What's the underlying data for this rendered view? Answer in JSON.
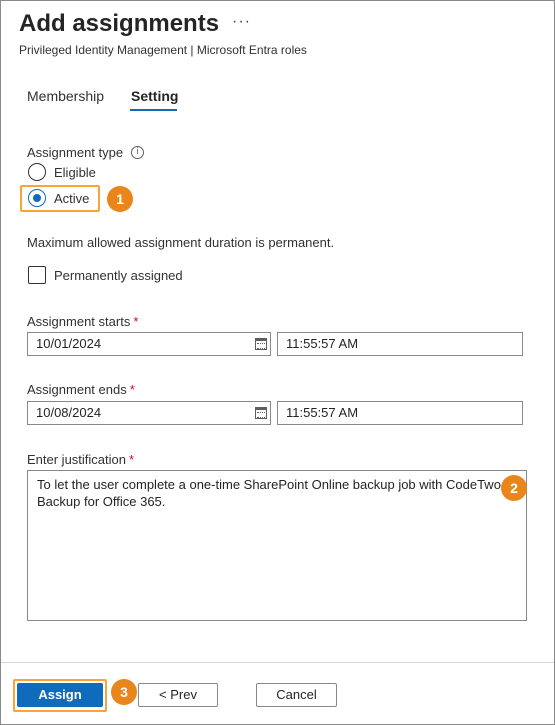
{
  "header": {
    "title": "Add assignments",
    "more_label": "···",
    "subtitle": "Privileged Identity Management | Microsoft Entra roles"
  },
  "tabs": {
    "membership": "Membership",
    "setting": "Setting",
    "active_tab": "Setting"
  },
  "assignment_type": {
    "label": "Assignment type",
    "info_glyph": "i",
    "options": [
      "Eligible",
      "Active"
    ],
    "selected": "Active",
    "callout": "1"
  },
  "duration_note": "Maximum allowed assignment duration is permanent.",
  "permanent": {
    "label": "Permanently assigned",
    "checked": false
  },
  "starts": {
    "label": "Assignment starts",
    "required_mark": "*",
    "date": "10/01/2024",
    "time": "11:55:57 AM"
  },
  "ends": {
    "label": "Assignment ends",
    "required_mark": "*",
    "date": "10/08/2024",
    "time": "11:55:57 AM"
  },
  "justification": {
    "label": "Enter justification",
    "required_mark": "*",
    "value": "To let the user complete a one-time SharePoint Online backup job with CodeTwo Backup for Office 365.",
    "callout": "2"
  },
  "footer": {
    "assign_label": "Assign",
    "prev_label": "< Prev",
    "cancel_label": "Cancel",
    "callout": "3"
  },
  "colors": {
    "accent": "#0f6cbd",
    "callout": "#e8861b",
    "highlight": "#f7a43a",
    "required": "#c50f1f"
  },
  "icons": {
    "more": "more-horizontal-icon",
    "info": "info-icon",
    "calendar": "calendar-icon"
  }
}
